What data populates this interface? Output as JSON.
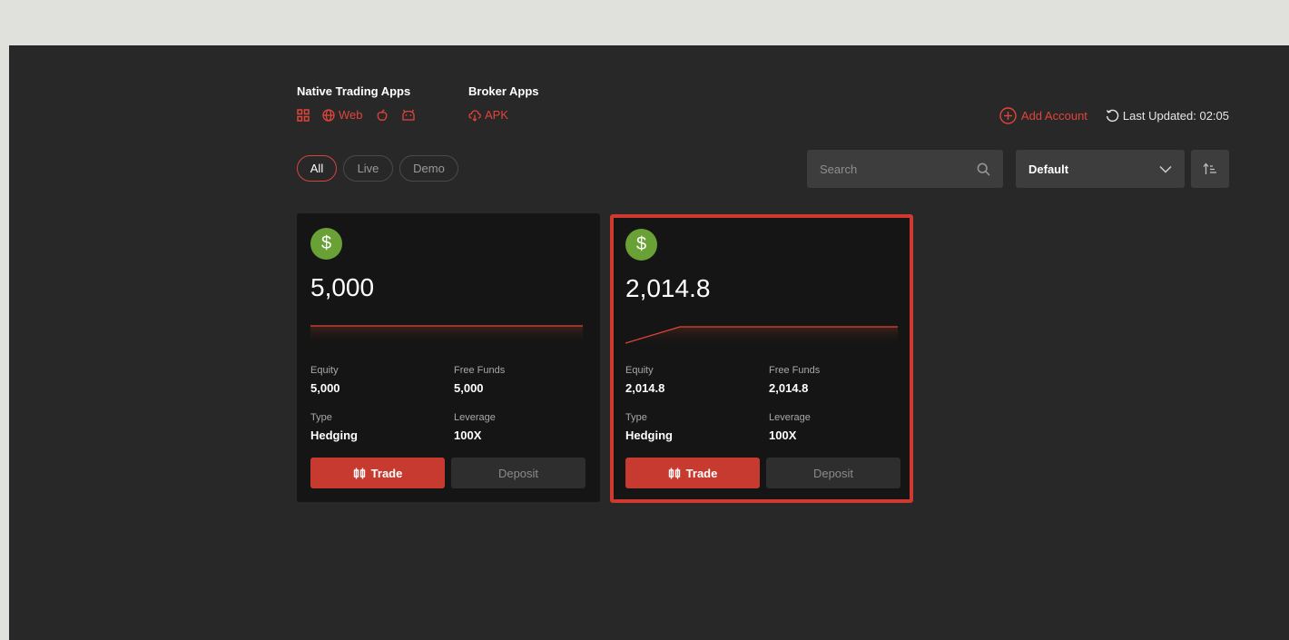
{
  "header": {
    "native_title": "Native Trading Apps",
    "native_links": [
      {
        "icon": "grid-icon",
        "label": ""
      },
      {
        "icon": "globe-icon",
        "label": "Web"
      },
      {
        "icon": "apple-icon",
        "label": ""
      },
      {
        "icon": "android-icon",
        "label": ""
      }
    ],
    "broker_title": "Broker Apps",
    "broker_link": {
      "icon": "cloud-download-icon",
      "label": "APK"
    },
    "add_account_label": "Add Account",
    "last_updated_label": "Last Updated: 02:05"
  },
  "filters": {
    "options": [
      "All",
      "Live",
      "Demo"
    ],
    "active": "All"
  },
  "search": {
    "placeholder": "Search",
    "value": ""
  },
  "sort": {
    "selected": "Default"
  },
  "accounts": [
    {
      "balance": "5,000",
      "equity_label": "Equity",
      "equity": "5,000",
      "free_funds_label": "Free Funds",
      "free_funds": "5,000",
      "type_label": "Type",
      "type": "Hedging",
      "leverage_label": "Leverage",
      "leverage": "100X",
      "trade_label": "Trade",
      "deposit_label": "Deposit",
      "selected": false,
      "sparkline": [
        5000,
        5000,
        5000,
        5000,
        5000,
        5000
      ]
    },
    {
      "balance": "2,014.8",
      "equity_label": "Equity",
      "equity": "2,014.8",
      "free_funds_label": "Free Funds",
      "free_funds": "2,014.8",
      "type_label": "Type",
      "type": "Hedging",
      "leverage_label": "Leverage",
      "leverage": "100X",
      "trade_label": "Trade",
      "deposit_label": "Deposit",
      "selected": true,
      "sparkline": [
        1980,
        2014.8,
        2014.8,
        2014.8,
        2014.8,
        2014.8
      ]
    }
  ],
  "colors": {
    "accent": "#e1443a",
    "coin": "#6aa136",
    "card_bg": "#151515",
    "page_bg": "#282828"
  }
}
